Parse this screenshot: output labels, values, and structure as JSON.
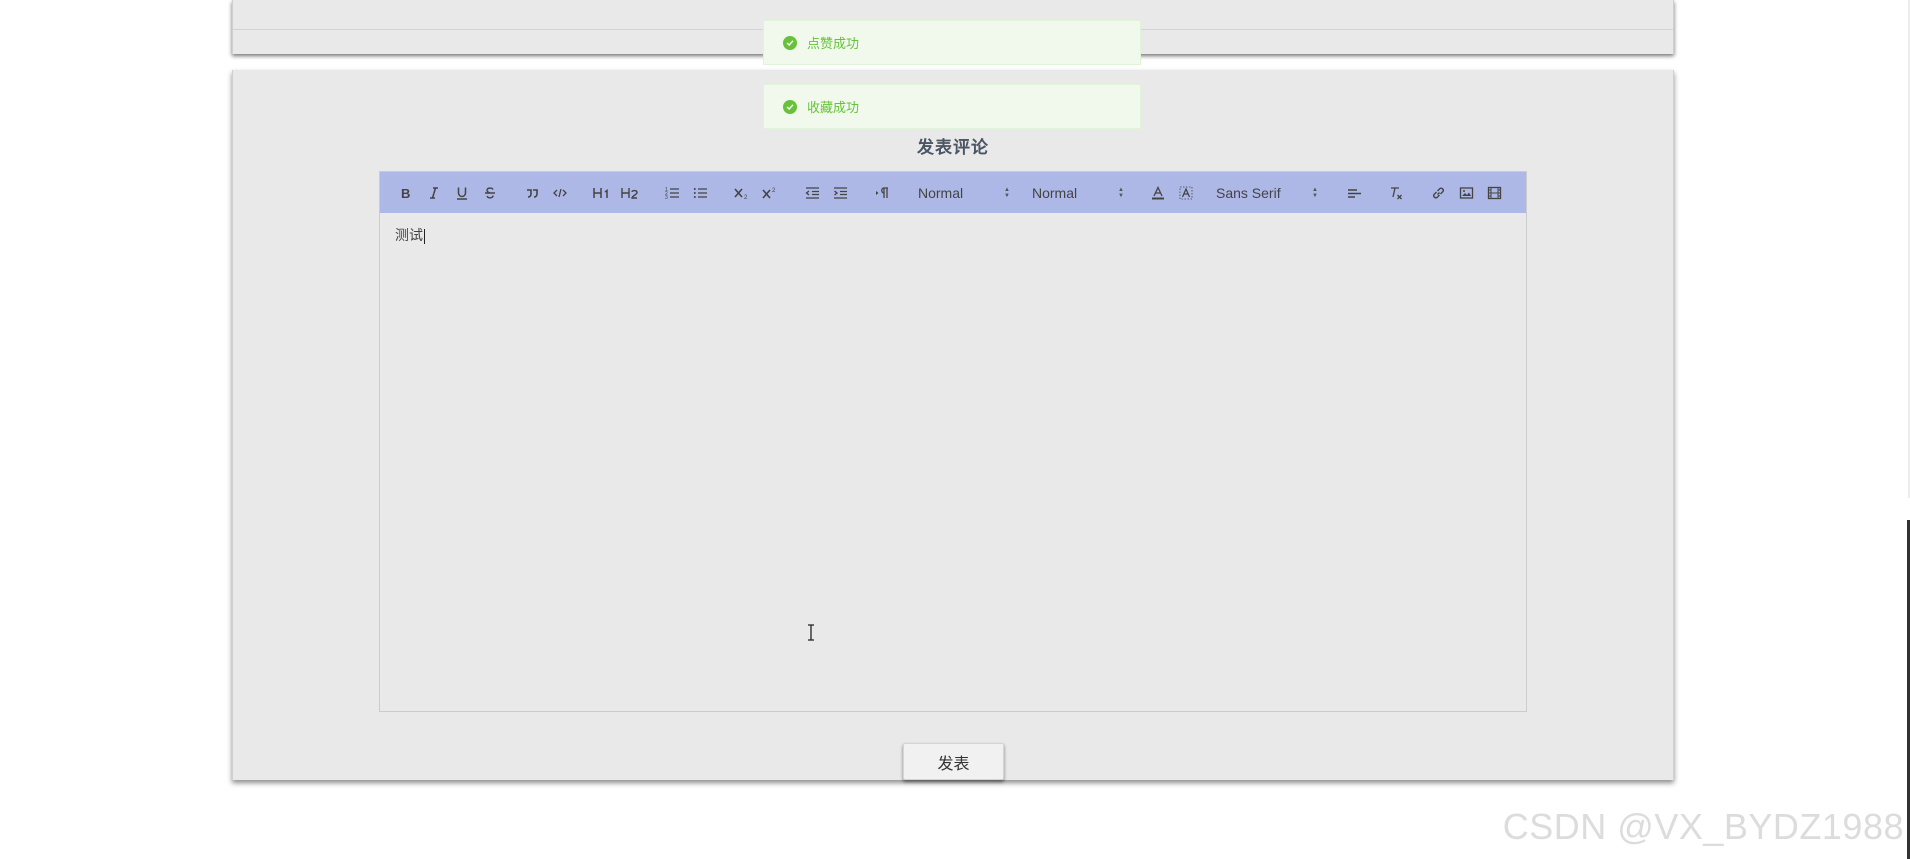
{
  "toasts": [
    {
      "text": "点赞成功"
    },
    {
      "text": "收藏成功"
    }
  ],
  "comment": {
    "title": "发表评论",
    "content": "测试",
    "submit_label": "发表"
  },
  "toolbar": {
    "header_size": "Normal",
    "font_size": "Normal",
    "font_family": "Sans Serif"
  },
  "colors": {
    "toolbar_bg": "#adb8e6",
    "card_bg": "#e9e9e9",
    "toast_bg": "#f0f9eb",
    "toast_text": "#67c23a"
  },
  "watermark": "CSDN @VX_BYDZ1988"
}
